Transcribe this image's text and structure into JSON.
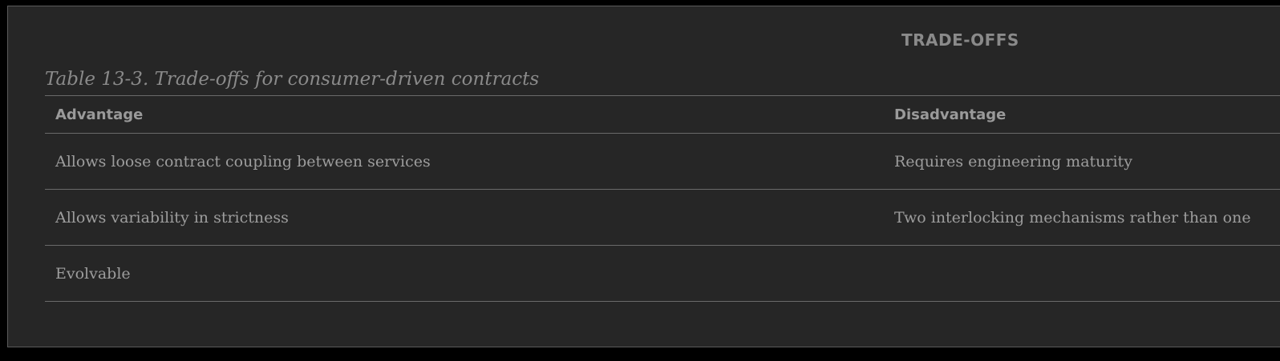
{
  "section": {
    "heading": "TRADE-OFFS"
  },
  "table": {
    "caption": "Table 13-3. Trade-offs for consumer-driven contracts",
    "headers": [
      "Advantage",
      "Disadvantage"
    ],
    "rows": [
      [
        "Allows loose contract coupling between services",
        "Requires engineering maturity"
      ],
      [
        "Allows variability in strictness",
        "Two interlocking mechanisms rather than one"
      ],
      [
        "Evolvable",
        ""
      ]
    ]
  },
  "colors": {
    "background": "#262626",
    "text": "#9d9d9d",
    "rule": "#6a6a6a"
  }
}
